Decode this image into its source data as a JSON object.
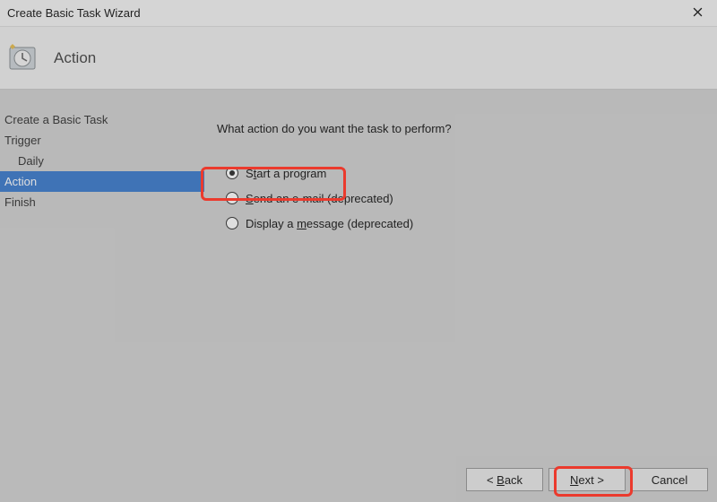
{
  "window": {
    "title": "Create Basic Task Wizard"
  },
  "header": {
    "step_title": "Action"
  },
  "sidebar": {
    "items": [
      {
        "label": "Create a Basic Task",
        "indent": false,
        "selected": false
      },
      {
        "label": "Trigger",
        "indent": false,
        "selected": false
      },
      {
        "label": "Daily",
        "indent": true,
        "selected": false
      },
      {
        "label": "Action",
        "indent": false,
        "selected": true
      },
      {
        "label": "Finish",
        "indent": false,
        "selected": false
      }
    ]
  },
  "content": {
    "prompt": "What action do you want the task to perform?",
    "options": [
      {
        "pre": "S",
        "ul": "t",
        "post": "art a program",
        "checked": true
      },
      {
        "pre": "",
        "ul": "S",
        "post": "end an e-mail (deprecated)",
        "checked": false
      },
      {
        "pre": "Display a ",
        "ul": "m",
        "post": "essage (deprecated)",
        "checked": false
      }
    ]
  },
  "footer": {
    "back": {
      "pre": "< ",
      "ul": "B",
      "post": "ack"
    },
    "next": {
      "pre": "",
      "ul": "N",
      "post": "ext >"
    },
    "cancel": {
      "pre": "Cancel",
      "ul": "",
      "post": ""
    }
  }
}
